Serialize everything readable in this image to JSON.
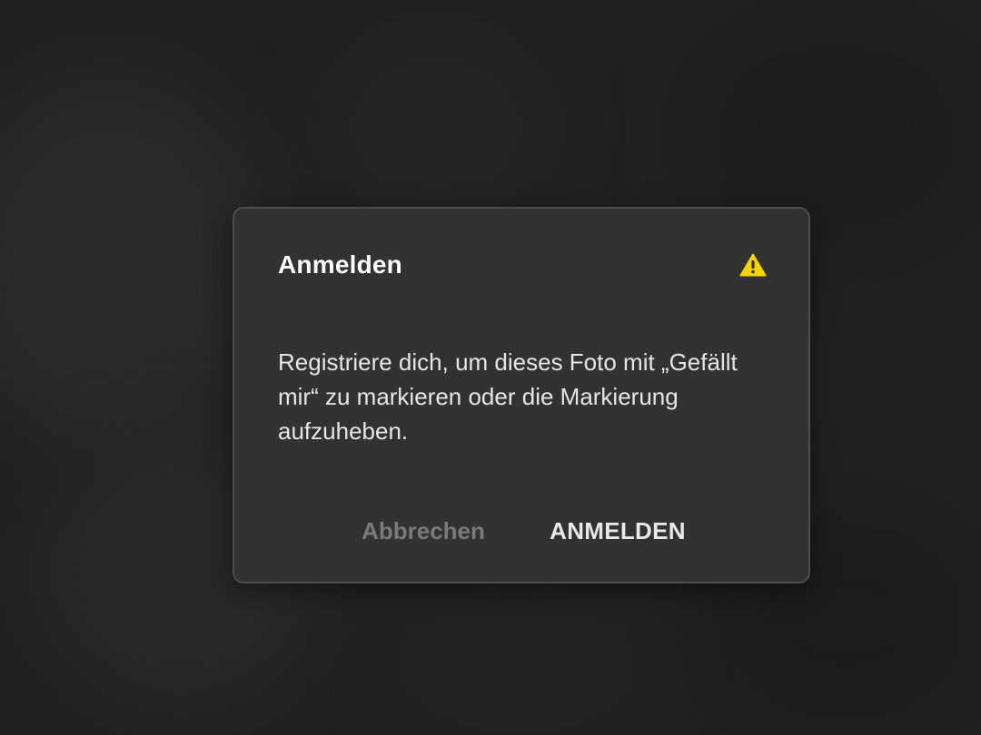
{
  "dialog": {
    "title": "Anmelden",
    "icon": "alert-icon",
    "icon_color": "#f5d400",
    "message": "Registriere dich, um dieses Foto mit „Gefällt mir“ zu markieren oder die Markierung aufzuheben.",
    "cancel_label": "Abbrechen",
    "confirm_label": "ANMELDEN"
  },
  "colors": {
    "backdrop": "#262626",
    "dialog_bg": "#323232",
    "dialog_border": "#4d4d4d",
    "cancel_text": "#7a7a7a",
    "confirm_text": "#e8e8e8"
  }
}
